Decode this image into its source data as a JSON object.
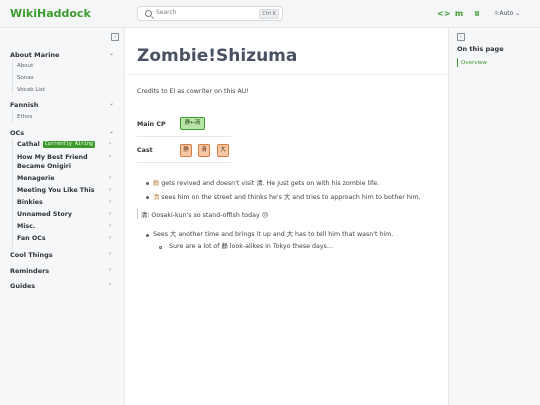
{
  "header": {
    "brand": "WikiHaddock",
    "search_placeholder": "Search",
    "search_shortcut": "Ctrl K",
    "theme_label": "Auto",
    "icons": [
      "code-icon",
      "mastodon-icon",
      "butterfly-icon"
    ]
  },
  "sidebar": {
    "sections": [
      {
        "label": "About Marine",
        "items": [
          "About",
          "Sonas",
          "Vocab List"
        ]
      },
      {
        "label": "Fannish",
        "items": [
          "Ethos"
        ]
      },
      {
        "label": "OCs",
        "items": []
      },
      {
        "label": "Cool Things",
        "items": []
      },
      {
        "label": "Reminders",
        "items": []
      },
      {
        "label": "Guides",
        "items": []
      }
    ],
    "ocs": [
      {
        "label": "Cathal",
        "badge": "Currently Airing"
      },
      {
        "label": "How My Best Friend Became Onigiri",
        "line1": "How My Best Friend",
        "line2": "Became Onigiri"
      },
      {
        "label": "Menagerie"
      },
      {
        "label": "Meeting You Like This"
      },
      {
        "label": "Binkies"
      },
      {
        "label": "Unnamed Story"
      },
      {
        "label": "Misc."
      },
      {
        "label": "Fan OCs"
      }
    ]
  },
  "main": {
    "title": "Zombie!Shizuma",
    "credits": "Credits to El as cowriter on this AU!",
    "main_cp_label": "Main CP",
    "main_cp": "静←清",
    "cast_label": "Cast",
    "cast": [
      "静",
      "清",
      "大"
    ],
    "bullets": [
      {
        "kanji": "静",
        "text": " gets revived and doesn't visit 清. He just gets on with his zombie life."
      },
      {
        "kanji": "清",
        "text": " sees him on the street and thinks he's 大 and tries to approach him to bother him."
      }
    ],
    "quote": "清: Oosaki-kun's so stand-offish today 😒",
    "bullet3": "Sees 大 another time and brings it up and 大 has to tell him that wasn't him.",
    "sub_bullet": "Sure are a lot of 静 look-alikes in Tokyo these days..."
  },
  "toc": {
    "title": "On this page",
    "items": [
      "Overview"
    ]
  },
  "colors": {
    "accent": "#3b9b2c",
    "cp_fill": "#b8e3a6",
    "cast_fill": "#f7c8a6"
  }
}
